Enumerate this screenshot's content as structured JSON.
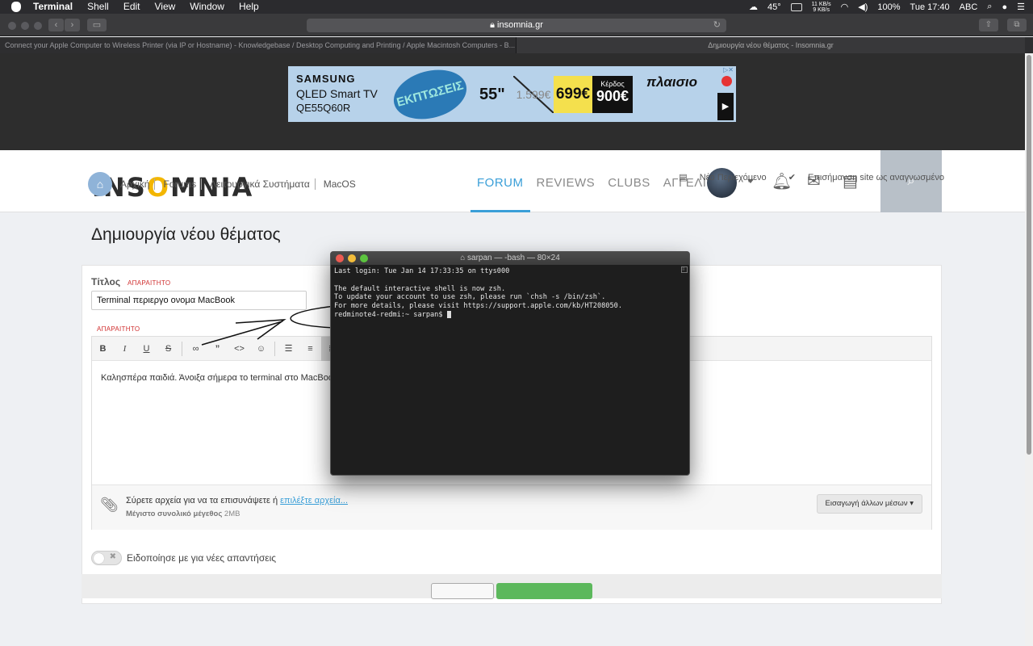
{
  "menubar": {
    "app": "Terminal",
    "items": [
      "Shell",
      "Edit",
      "View",
      "Window",
      "Help"
    ],
    "temp": "45°",
    "net_up": "11 KB/s",
    "net_down": "9 KB/s",
    "battery": "100%",
    "clock": "Tue 17:40",
    "input": "ABC"
  },
  "browser": {
    "url": "insomnia.gr",
    "tabs": [
      "Connect your Apple Computer to Wireless Printer (via IP or Hostname) - Knowledgebase / Desktop Computing and Printing / Apple Macintosh Computers - B...",
      "Δημιουργία νέου θέματος - Insomnia.gr"
    ]
  },
  "ad": {
    "brand": "SAMSUNG",
    "product": "QLED Smart TV",
    "model": "QE55Q60R",
    "badge": "ΕΚΠΤΩΣΕΙΣ",
    "size": "55\"",
    "old_price": "1.599€",
    "new_price": "699€",
    "save_label": "Κέρδος",
    "save_value": "900€",
    "store": "πλαισιο"
  },
  "site": {
    "logo_a": "INS",
    "logo_o": "O",
    "logo_b": "MNIA",
    "nav": [
      "FORUM",
      "REVIEWS",
      "CLUBS",
      "ΑΓΓΕΛΙΕΣ"
    ]
  },
  "crumbs": [
    "Αρχική",
    "Forums",
    "Λειτουργικά Συστήματα",
    "MacOS"
  ],
  "pagetools": {
    "new_content": "Νέο Περιεχόμενο",
    "mark_read": "Επισήμανση site ως αναγνωσμένο"
  },
  "form": {
    "page_title": "Δημιουργία νέου θέματος",
    "title_label": "Τίτλος",
    "required": "ΑΠΑΡΑΙΤΗΤΟ",
    "title_value": "Terminal περιεργο ονομα MacBook",
    "body_text": "Καλησπέρα παιδιά. Άνοιξα σήμερα το terminal στο MacBook",
    "attach_text": "Σύρετε αρχεία για να τα επισυνάψετε ή ",
    "attach_link": "επιλέξτε αρχεία...",
    "max_label": "Μέγιστο συνολικό μέγεθος",
    "max_value": "2MB",
    "more_media": "Εισαγωγή άλλων μέσων ▾",
    "notify": "Ειδοποίησε με για νέες απαντήσεις"
  },
  "terminal": {
    "title": "sarpan — -bash — 80×24",
    "lines": [
      "Last login: Tue Jan 14 17:33:35 on ttys000",
      "",
      "The default interactive shell is now zsh.",
      "To update your account to use zsh, please run `chsh -s /bin/zsh`.",
      "For more details, please visit https://support.apple.com/kb/HT208050."
    ],
    "prompt": "redminote4-redmi:~ sarpan$ "
  }
}
